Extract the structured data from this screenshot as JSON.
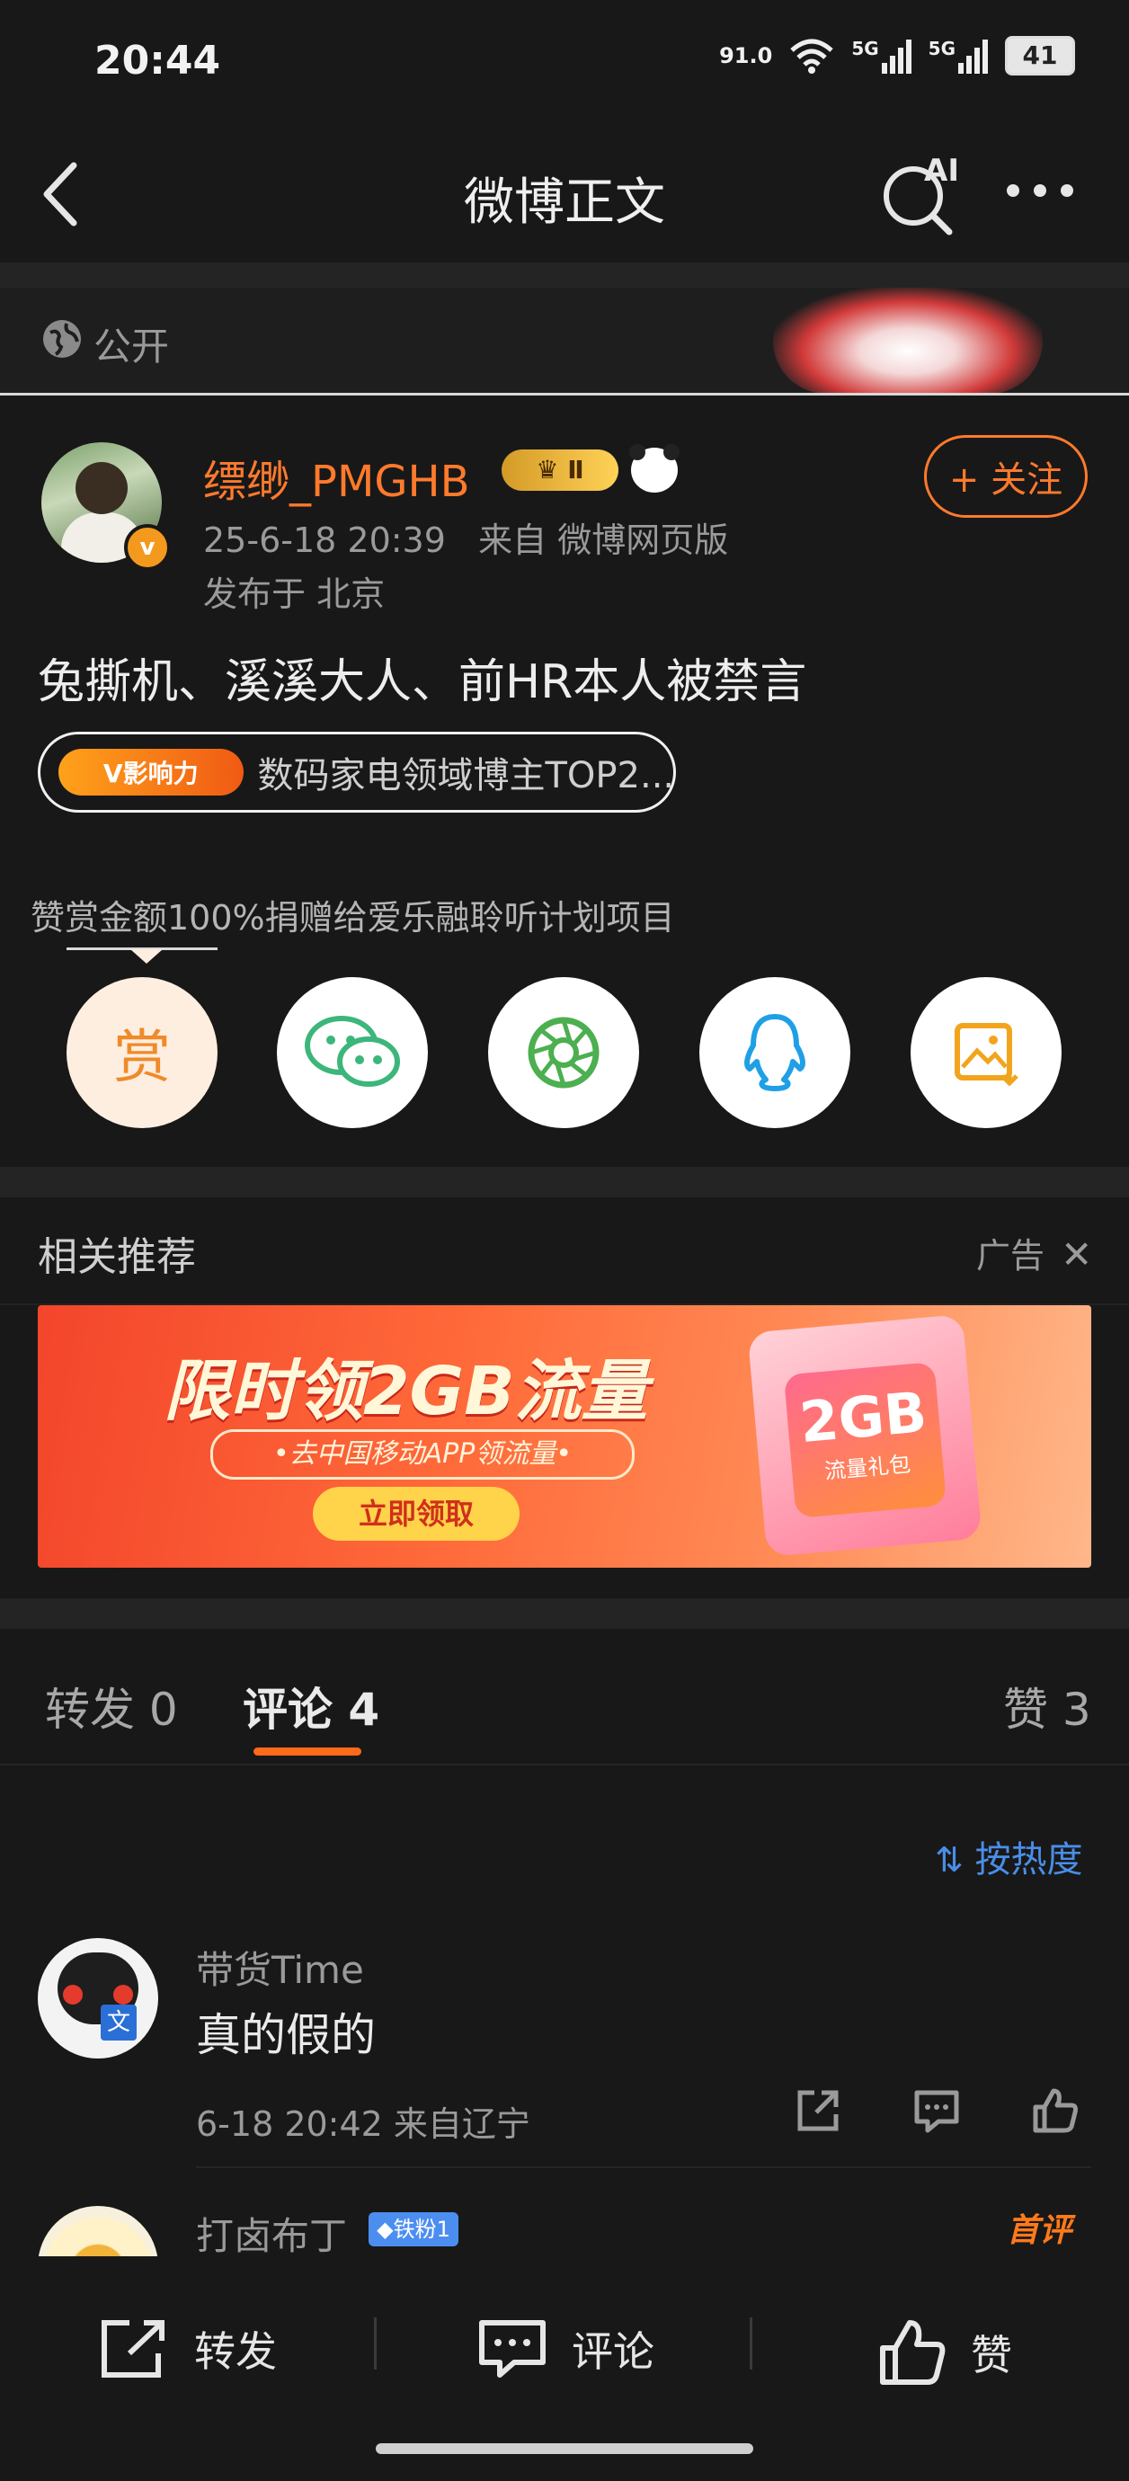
{
  "status_bar": {
    "time": "20:44",
    "net_speed_top": "91.0",
    "net_speed_bottom": "",
    "signal1": "5G",
    "signal2": "5G",
    "battery": "41"
  },
  "nav": {
    "title": "微博正文",
    "ai_label": "AI"
  },
  "visibility": {
    "label": "公开"
  },
  "author": {
    "name": "缥缈_PMGHB",
    "level_badge": "Ⅱ",
    "time": "25-6-18 20:39",
    "source": "来自 微博网页版",
    "location": "发布于 北京",
    "follow_label": "+ 关注"
  },
  "post": {
    "text": "兔撕机、溪溪大人、前HR本人被禁言",
    "tag_badge": "V影响力",
    "tag_text": "数码家电领域博主TOP2..."
  },
  "reward": {
    "text": "赞赏金额100%捐赠给爱乐融聆听计划项目",
    "reward_icon": "赏"
  },
  "share_buttons": [
    {
      "name": "reward-icon"
    },
    {
      "name": "wechat-icon"
    },
    {
      "name": "moments-icon"
    },
    {
      "name": "qq-icon"
    },
    {
      "name": "save-image-icon"
    }
  ],
  "related": {
    "title": "相关推荐",
    "ad_label": "广告",
    "ad_headline": "限时领2GB流量",
    "ad_sub": "•去中国移动APP领流量•",
    "ad_button": "立即领取",
    "ad_card_big": "2GB",
    "ad_card_small": "流量礼包"
  },
  "tabs": {
    "repost": "转发 0",
    "comment": "评论 4",
    "like": "赞 3"
  },
  "sort_label": "按热度",
  "comments": [
    {
      "user": "带货Time",
      "text": "真的假的",
      "meta": "6-18 20:42 来自辽宁",
      "avatar_text": "文"
    },
    {
      "user": "打卤布丁",
      "fan_badge": "铁粉1",
      "first_badge": "首评"
    }
  ],
  "bottom_bar": {
    "repost": "转发",
    "comment": "评论",
    "like": "赞"
  },
  "colors": {
    "accent": "#ff7a2c",
    "link_blue": "#4a8ee8",
    "background": "#181818"
  }
}
